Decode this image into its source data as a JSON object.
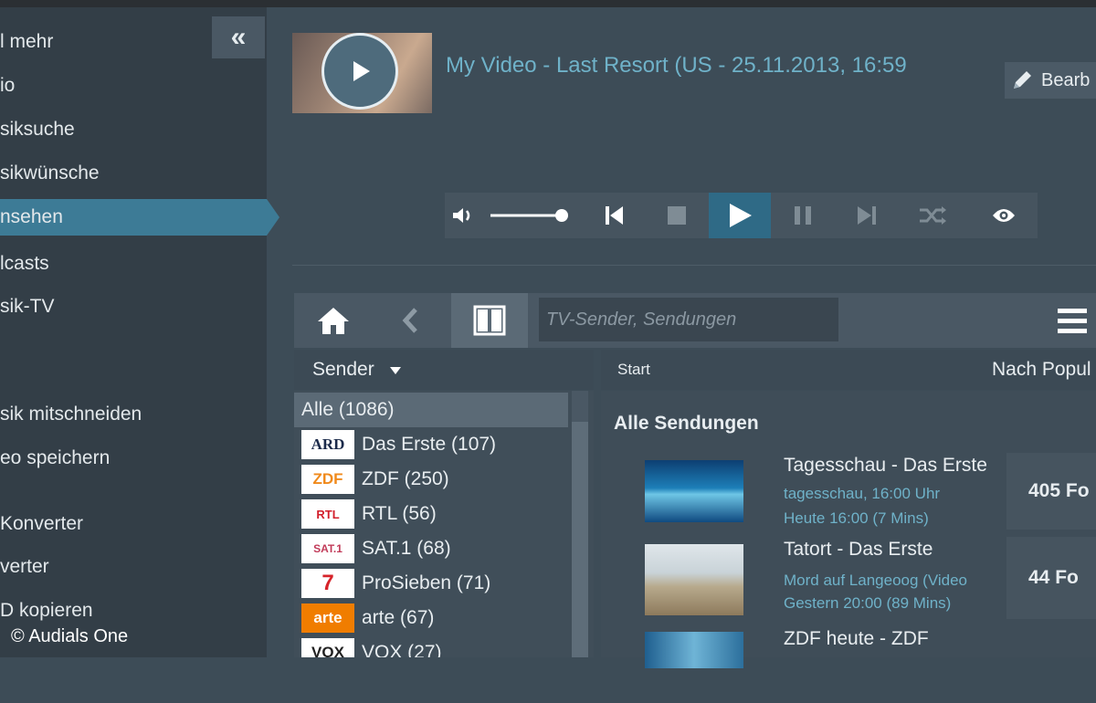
{
  "sidebar": {
    "collapse_label": "«",
    "items": [
      {
        "label": "l mehr"
      },
      {
        "label": "io"
      },
      {
        "label": "siksuche"
      },
      {
        "label": "sikwünsche"
      },
      {
        "label": "nsehen",
        "active": true
      },
      {
        "label": "lcasts"
      },
      {
        "label": "sik-TV"
      },
      {
        "label": "sik mitschneiden"
      },
      {
        "label": "eo speichern"
      },
      {
        "label": "Konverter"
      },
      {
        "label": "verter"
      },
      {
        "label": "D kopieren"
      }
    ]
  },
  "watermark": "© Audials One",
  "player": {
    "title": "My Video - Last Resort (US - 25.11.2013, 16:59",
    "edit_label": "Bearb",
    "icons": [
      "volume-icon",
      "previous-icon",
      "stop-icon",
      "play-icon",
      "pause-icon",
      "next-icon",
      "shuffle-icon",
      "eye-icon"
    ],
    "volume_level": 0.8
  },
  "browser": {
    "search_placeholder": "TV-Sender, Sendungen",
    "sender_label": "Sender",
    "col_start": "Start",
    "col_sort": "Nach Popul",
    "channels": [
      {
        "logo": "ARD",
        "label": "Das Erste (107)"
      },
      {
        "logo": "ZDF",
        "label": "ZDF (250)"
      },
      {
        "logo": "RTL",
        "label": "RTL (56)"
      },
      {
        "logo": "SAT.1",
        "label": "SAT.1 (68)"
      },
      {
        "logo": "7",
        "label": "ProSieben (71)"
      },
      {
        "logo": "arte",
        "label": "arte (67)"
      },
      {
        "logo": "VOX",
        "label": "VOX (27)"
      }
    ],
    "all_label": "Alle (1086)",
    "section_title": "Alle Sendungen",
    "shows": [
      {
        "title": "Tagesschau - Das Erste",
        "line1": "tagesschau, 16:00 Uhr",
        "line2": "Heute 16:00 (7 Mins)",
        "count": "405 Fo"
      },
      {
        "title": "Tatort - Das Erste",
        "line1": "Mord auf Langeoog (Video",
        "line2": "Gestern 20:00 (89 Mins)",
        "count": "44 Fo"
      },
      {
        "title": "ZDF heute - ZDF",
        "line1": "",
        "line2": "",
        "count": ""
      }
    ]
  },
  "colors": {
    "accent": "#3d7b96",
    "link": "#6fb2c9"
  }
}
